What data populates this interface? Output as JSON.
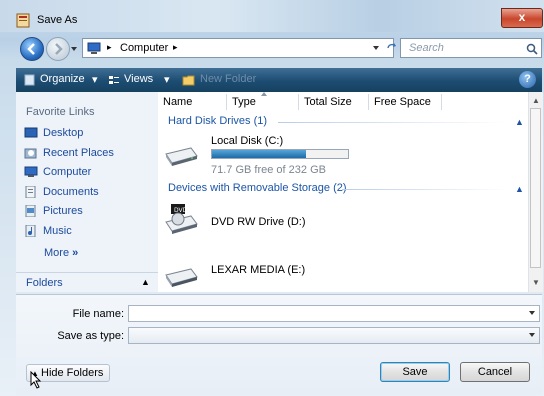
{
  "window": {
    "title": "Save As",
    "close_glyph": "x"
  },
  "nav": {
    "path_root_icon": "computer-icon",
    "path": [
      "Computer"
    ],
    "search_placeholder": "Search"
  },
  "toolbar": {
    "organize": "Organize",
    "views": "Views",
    "new_folder": "New Folder",
    "help": "?"
  },
  "favorites": {
    "title": "Favorite Links",
    "items": [
      {
        "label": "Desktop",
        "icon": "desktop-icon"
      },
      {
        "label": "Recent Places",
        "icon": "recent-places-icon"
      },
      {
        "label": "Computer",
        "icon": "computer-icon"
      },
      {
        "label": "Documents",
        "icon": "documents-icon"
      },
      {
        "label": "Pictures",
        "icon": "pictures-icon"
      },
      {
        "label": "Music",
        "icon": "music-icon"
      }
    ],
    "more": "More",
    "more_glyph": "»",
    "folders": "Folders"
  },
  "columns": [
    "Name",
    "Type",
    "Total Size",
    "Free Space"
  ],
  "groups": [
    {
      "title": "Hard Disk Drives (1)",
      "drives": [
        {
          "name": "Local Disk (C:)",
          "free_text": "71.7 GB free of 232 GB",
          "used_fraction": 0.69,
          "icon": "hard-disk-icon"
        }
      ]
    },
    {
      "title": "Devices with Removable Storage (2)",
      "drives": [
        {
          "name": "DVD RW Drive (D:)",
          "icon": "dvd-drive-icon",
          "badge": "DVD"
        },
        {
          "name": "LEXAR MEDIA (E:)",
          "icon": "usb-drive-icon"
        }
      ]
    }
  ],
  "form": {
    "file_name_label": "File name:",
    "file_name_value": "",
    "save_type_label": "Save as type:",
    "save_type_value": ""
  },
  "buttons": {
    "hide_folders": "Hide Folders",
    "save": "Save",
    "cancel": "Cancel"
  },
  "colors": {
    "toolbar": "#1d4c73",
    "link": "#1c4a9d",
    "group": "#1c55a8",
    "close": "#c9462c"
  }
}
